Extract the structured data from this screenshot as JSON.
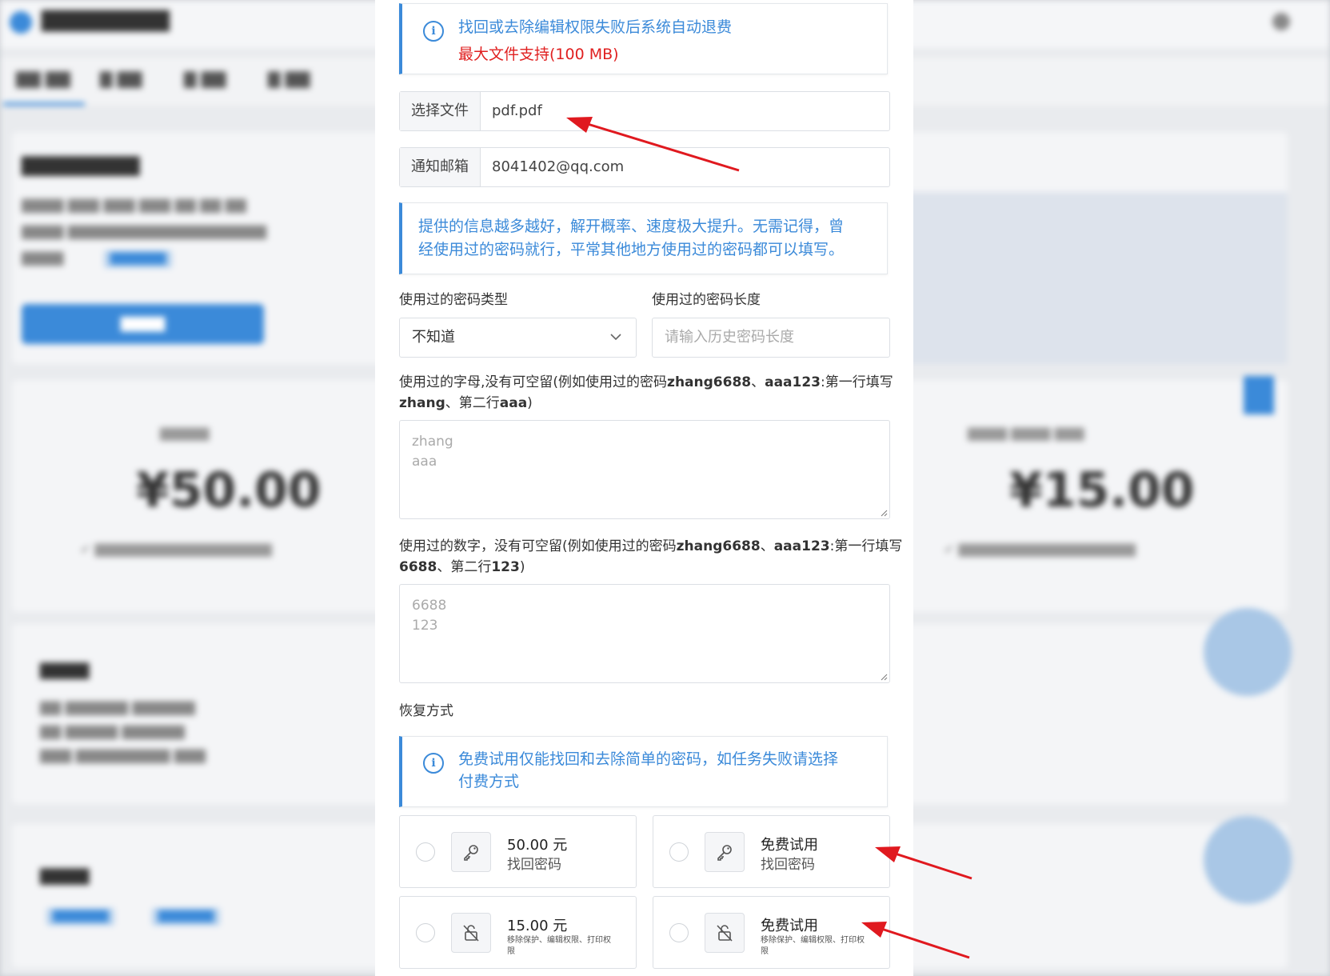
{
  "notice": {
    "refund_text": "找回或去除编辑权限失败后系统自动退费",
    "max_size_text": "最大文件支持(100 MB)"
  },
  "file_field": {
    "addon": "选择文件",
    "value": "pdf.pdf"
  },
  "email_field": {
    "addon": "通知邮箱",
    "value": "8041402@qq.com"
  },
  "hint": {
    "line1": "提供的信息越多越好，解开概率、速度极大提升。无需记得，曾",
    "line2": "经使用过的密码就行，平常其他地方使用过的密码都可以填写。"
  },
  "password_type": {
    "label": "使用过的密码类型",
    "selected": "不知道"
  },
  "password_length": {
    "label": "使用过的密码长度",
    "placeholder": "请输入历史密码长度"
  },
  "letters": {
    "label_line1": "使用过的字母,没有可空留(例如使用过的密码",
    "label_bold1": "zhang6688",
    "label_mid": "、",
    "label_bold2": "aaa123",
    "label_tail": ":第一行填写",
    "label_line2a": "zhang",
    "label_line2b": "、第二行",
    "label_line2c": "aaa",
    "label_line2d": ")",
    "placeholder": "zhang\naaa"
  },
  "digits": {
    "label_line1": "使用过的数字，没有可空留(例如使用过的密码",
    "label_bold1": "zhang6688",
    "label_mid": "、",
    "label_bold2": "aaa123",
    "label_tail": ":第一行填写",
    "label_line2a": "6688",
    "label_line2b": "、第二行",
    "label_line2c": "123",
    "label_line2d": ")",
    "placeholder": "6688\n123"
  },
  "recovery": {
    "label": "恢复方式",
    "notice_line1": "免费试用仅能找回和去除简单的密码，如任务失败请选择",
    "notice_line2": "付费方式",
    "options": [
      {
        "title": "50.00 元",
        "subtitle": "找回密码",
        "icon": "key-icon"
      },
      {
        "title": "免费试用",
        "subtitle": "找回密码",
        "icon": "key-icon"
      },
      {
        "title": "15.00 元",
        "subtitle": "移除保护、编辑权限、打印权限",
        "icon": "unlock-icon"
      },
      {
        "title": "免费试用",
        "subtitle": "移除保护、编辑权限、打印权限",
        "icon": "unlock-icon"
      }
    ]
  },
  "background": {
    "prices": [
      "¥50.00",
      "¥15.00"
    ]
  },
  "colors": {
    "accent": "#3b8ad9",
    "danger": "#e02020",
    "arrow": "#e0191f"
  }
}
